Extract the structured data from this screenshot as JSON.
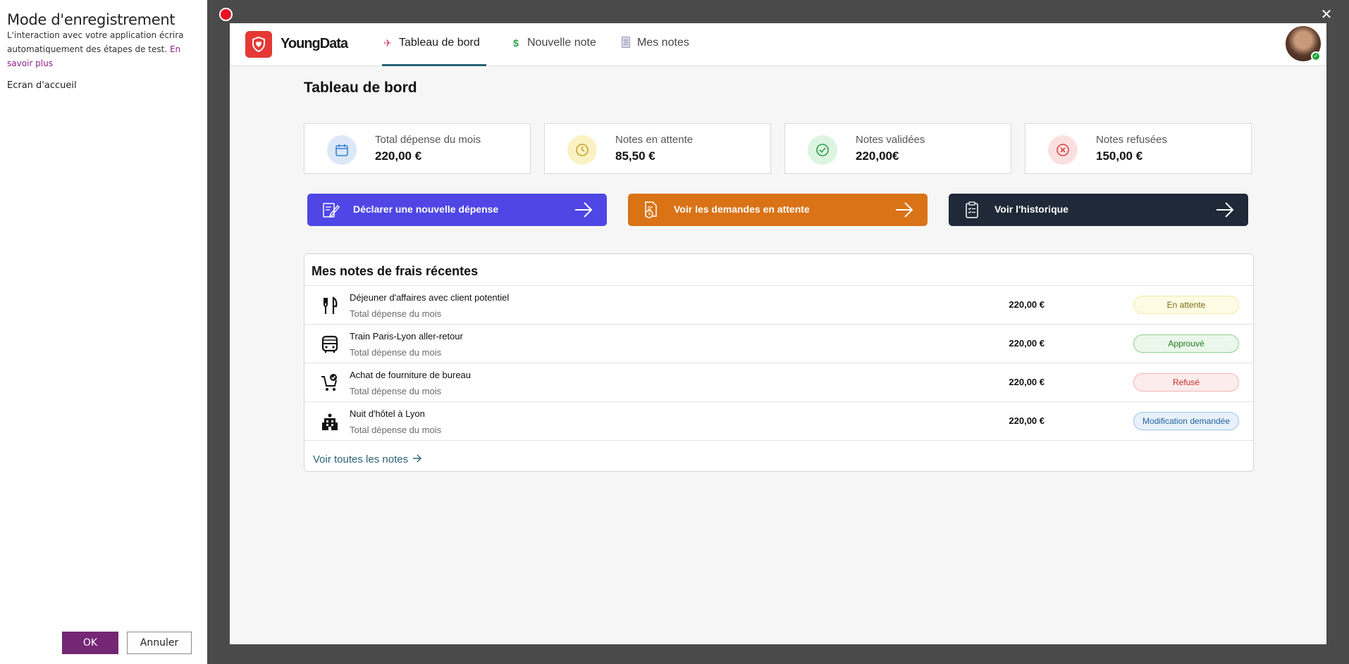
{
  "recorder": {
    "title": "Mode d'enregistrement",
    "description": "L'interaction avec votre application écrira automatiquement des étapes de test.",
    "learn_more": "En savoir plus",
    "screen_name": "Ecran d'accueil",
    "ok_label": "OK",
    "cancel_label": "Annuler"
  },
  "window": {
    "close_glyph": "✕"
  },
  "app": {
    "brand": "YoungData",
    "nav": [
      {
        "label": "Tableau de bord",
        "icon": "rocket-icon"
      },
      {
        "label": "Nouvelle note",
        "icon": "dollar-icon"
      },
      {
        "label": "Mes notes",
        "icon": "document-icon"
      }
    ],
    "page_title": "Tableau de bord"
  },
  "stats": [
    {
      "label": "Total dépense du mois",
      "value": "220,00 €",
      "icon": "calendar-icon",
      "color": "#3b82d6"
    },
    {
      "label": "Notes en attente",
      "value": "85,50 €",
      "icon": "clock-icon",
      "color": "#c9a227"
    },
    {
      "label": "Notes validées",
      "value": "220,00€",
      "icon": "check-circle-icon",
      "color": "#2e9e4b"
    },
    {
      "label": "Notes refusées",
      "value": "150,00 €",
      "icon": "x-circle-icon",
      "color": "#d64545"
    }
  ],
  "actions": [
    {
      "label": "Déclarer une nouvelle dépense",
      "color": "#4f46e5",
      "icon": "edit-document-icon"
    },
    {
      "label": "Voir les demandes en attente",
      "color": "#d97316",
      "icon": "pending-document-icon"
    },
    {
      "label": "Voir l'historique",
      "color": "#1f2937",
      "icon": "clipboard-list-icon"
    }
  ],
  "recent": {
    "title": "Mes notes de frais récentes",
    "rows": [
      {
        "title": "Déjeuner d'affaires avec client potentiel",
        "subtitle": "Total dépense du mois",
        "amount": "220,00 €",
        "status": "En attente",
        "icon": "cutlery-icon"
      },
      {
        "title": "Train Paris-Lyon aller-retour",
        "subtitle": "Total dépense du mois",
        "amount": "220,00 €",
        "status": "Approuvé",
        "icon": "bus-icon"
      },
      {
        "title": "Achat de fourniture de bureau",
        "subtitle": "Total dépense du mois",
        "amount": "220,00 €",
        "status": "Refusé",
        "icon": "cart-icon"
      },
      {
        "title": "Nuit d'hôtel à Lyon",
        "subtitle": "Total dépense du mois",
        "amount": "220,00 €",
        "status": "Modification demandée",
        "icon": "hotel-icon"
      }
    ],
    "see_all": "Voir toutes les notes"
  }
}
